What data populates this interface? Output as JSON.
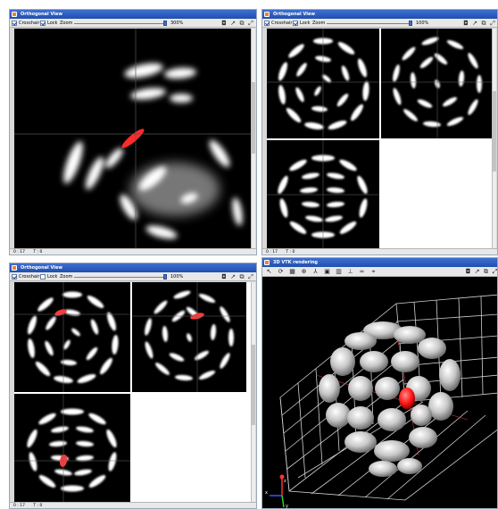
{
  "windows": [
    {
      "id": "w1",
      "title": "Orthogonal View",
      "toolbar": {
        "crosshair_label": "Crosshair",
        "lock_label": "Lock",
        "zoom_label": "Zoom",
        "zoom_value": "300%"
      },
      "status": {
        "left": "0 : 17",
        "right": "T : 0"
      }
    },
    {
      "id": "w2",
      "title": "Orthogonal View",
      "toolbar": {
        "crosshair_label": "Crosshair",
        "lock_label": "Lock",
        "zoom_label": "Zoom",
        "zoom_value": "100%"
      },
      "status": {
        "left": "0 : 17",
        "right": "T : 0"
      }
    },
    {
      "id": "w3",
      "title": "Orthogonal View",
      "toolbar": {
        "crosshair_label": "Crosshair",
        "lock_label": "Lock",
        "zoom_label": "Zoom",
        "zoom_value": "100%"
      },
      "status": {
        "left": "0 : 17",
        "right": "T : 0"
      }
    },
    {
      "id": "w4",
      "title": "3D VTK rendering"
    }
  ],
  "colors": {
    "titlebar": "#2b5cc0",
    "highlight": "#ff2222",
    "background": "#000000"
  },
  "icons": [
    "camera-icon",
    "pointer-icon",
    "copy-icon",
    "resize-icon",
    "rotate-icon",
    "zoom-icon",
    "axes-icon"
  ]
}
